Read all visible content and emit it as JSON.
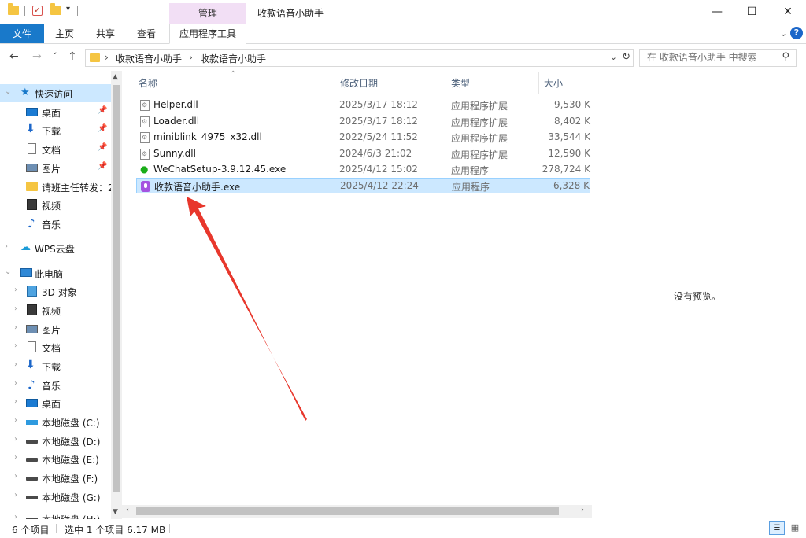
{
  "window": {
    "title": "收款语音小助手",
    "context_tab_header": "管理",
    "minimize": "—",
    "maximize": "☐",
    "close": "✕"
  },
  "ribbon": {
    "tabs": [
      "文件",
      "主页",
      "共享",
      "查看",
      "应用程序工具"
    ],
    "accent": "#1979ca",
    "context_accent": "#f2dff5"
  },
  "navigation": {
    "back": "←",
    "forward": "→",
    "recent": "˅",
    "up": "↑"
  },
  "address": {
    "segments": [
      "收款语音小助手",
      "收款语音小助手"
    ]
  },
  "search": {
    "placeholder": "在 收款语音小助手 中搜索"
  },
  "sidebar": {
    "quick_access": "快速访问",
    "quick_items": [
      "桌面",
      "下载",
      "文档",
      "图片",
      "请班主任转发：2",
      "视频",
      "音乐"
    ],
    "wps": "WPS云盘",
    "this_pc": "此电脑",
    "pc_items": [
      "3D 对象",
      "视频",
      "图片",
      "文档",
      "下载",
      "音乐",
      "桌面",
      "本地磁盘 (C:)",
      "本地磁盘 (D:)",
      "本地磁盘 (E:)",
      "本地磁盘 (F:)",
      "本地磁盘 (G:)",
      "本地磁盘 (H:)"
    ]
  },
  "file_list": {
    "columns": [
      "名称",
      "修改日期",
      "类型",
      "大小"
    ],
    "rows": [
      {
        "name": "Helper.dll",
        "date": "2025/3/17 18:12",
        "type": "应用程序扩展",
        "size": "9,530 K",
        "icon": "dll-icon"
      },
      {
        "name": "Loader.dll",
        "date": "2025/3/17 18:12",
        "type": "应用程序扩展",
        "size": "8,402 K",
        "icon": "dll-icon"
      },
      {
        "name": "miniblink_4975_x32.dll",
        "date": "2022/5/24 11:52",
        "type": "应用程序扩展",
        "size": "33,544 K",
        "icon": "dll-icon"
      },
      {
        "name": "Sunny.dll",
        "date": "2024/6/3 21:02",
        "type": "应用程序扩展",
        "size": "12,590 K",
        "icon": "dll-icon"
      },
      {
        "name": "WeChatSetup-3.9.12.45.exe",
        "date": "2025/4/12 15:02",
        "type": "应用程序",
        "size": "278,724 K",
        "icon": "wechat-icon"
      },
      {
        "name": "收款语音小助手.exe",
        "date": "2025/4/12 22:24",
        "type": "应用程序",
        "size": "6,328 K",
        "icon": "app-mic-icon"
      }
    ],
    "selected_index": 5
  },
  "preview": {
    "text": "没有预览。"
  },
  "status": {
    "item_count": "6 个项目",
    "selection": "选中 1 个项目  6.17 MB"
  },
  "annotation": {
    "arrow_color": "#e8372c"
  }
}
